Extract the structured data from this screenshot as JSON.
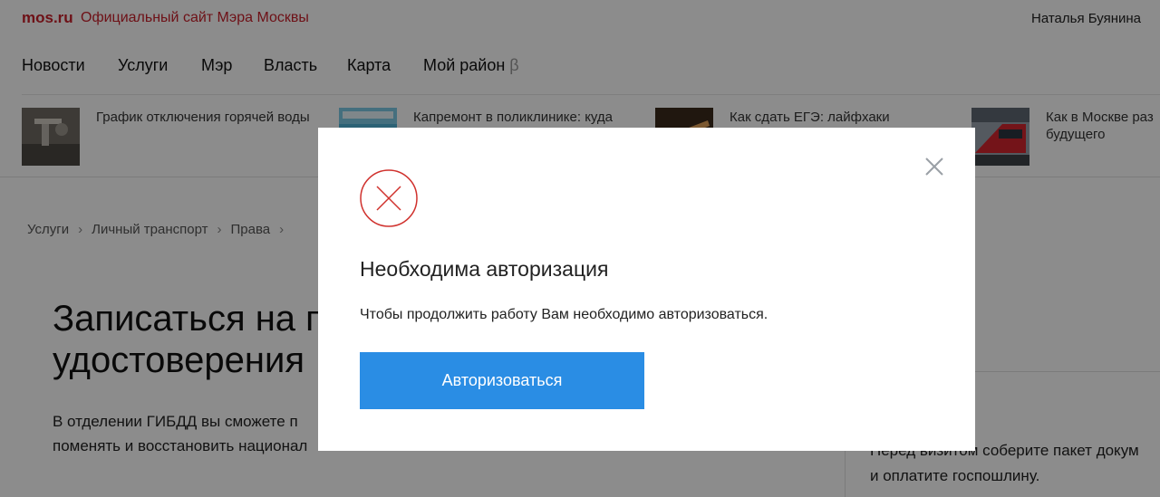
{
  "header": {
    "logo": "mos.ru",
    "tagline": "Официальный сайт Мэра Москвы",
    "user_name": "Наталья Буянина"
  },
  "nav": {
    "items": [
      "Новости",
      "Услуги",
      "Мэр",
      "Власть",
      "Карта",
      "Мой район"
    ],
    "beta_mark": "β"
  },
  "news": [
    {
      "title": "График отключения горячей воды",
      "thumb_icon": "faucet-photo"
    },
    {
      "title": "Капремонт в поликлинике: куда",
      "thumb_icon": "clinic-photo"
    },
    {
      "title": "Как сдать ЕГЭ: лайфхаки",
      "thumb_icon": "exam-photo"
    },
    {
      "title": "Как в Москве раз\nбудущего",
      "thumb_icon": "train-photo"
    }
  ],
  "breadcrumb": [
    "Услуги",
    "Личный транспорт",
    "Права"
  ],
  "page": {
    "title": "Записаться на п\nудостоверения",
    "lead": "В отделении ГИБДД вы сможете п\nпоменять и восстановить национал",
    "sidebar_text": "Перед визитом соберите пакет докум\nи оплатите госпошлину."
  },
  "modal": {
    "title": "Необходима авторизация",
    "message": "Чтобы продолжить работу Вам необходимо авторизоваться.",
    "button_label": "Авторизоваться",
    "close_icon": "close-icon",
    "status_icon": "error-x-icon"
  },
  "colors": {
    "brand_red": "#c8202b",
    "button_blue": "#2a8de4",
    "overlay": "rgba(0,0,0,0.45)"
  }
}
